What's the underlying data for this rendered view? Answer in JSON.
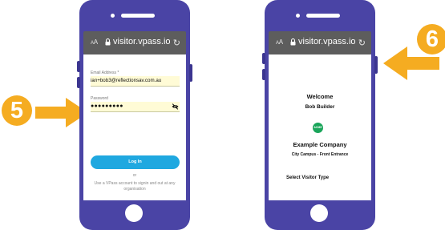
{
  "colors": {
    "phone_frame": "#4a44a5",
    "url_bar": "#5d5d5d",
    "field_autofill": "#fffbd6",
    "login_button": "#1fa8e0",
    "logo_green": "#1aa55a",
    "step_accent": "#f5ac21"
  },
  "steps": {
    "step5_number": "5",
    "step6_number": "6"
  },
  "browser": {
    "text_size_big": "A",
    "text_size_small": "A",
    "url": "visitor.vpass.io",
    "lock_icon": "lock-icon",
    "reload_icon": "reload-icon"
  },
  "login": {
    "email_label": "Email Address *",
    "email_value": "ian+bob3@reflectionsav.com.au",
    "password_label": "Password",
    "password_value": "●●●●●●●●●",
    "password_toggle_icon": "eye-slash-icon",
    "login_button": "Log In",
    "or_text": "or",
    "vpass_note": "Use a VPass account to signin and out at any organisation"
  },
  "welcome": {
    "heading": "Welcome",
    "visitor_name": "Bob Builder",
    "logo_text": "ACME",
    "company_name": "Example Company",
    "location": "City Campus - Front Entrance",
    "select_visitor_type": "Select Visitor Type"
  }
}
